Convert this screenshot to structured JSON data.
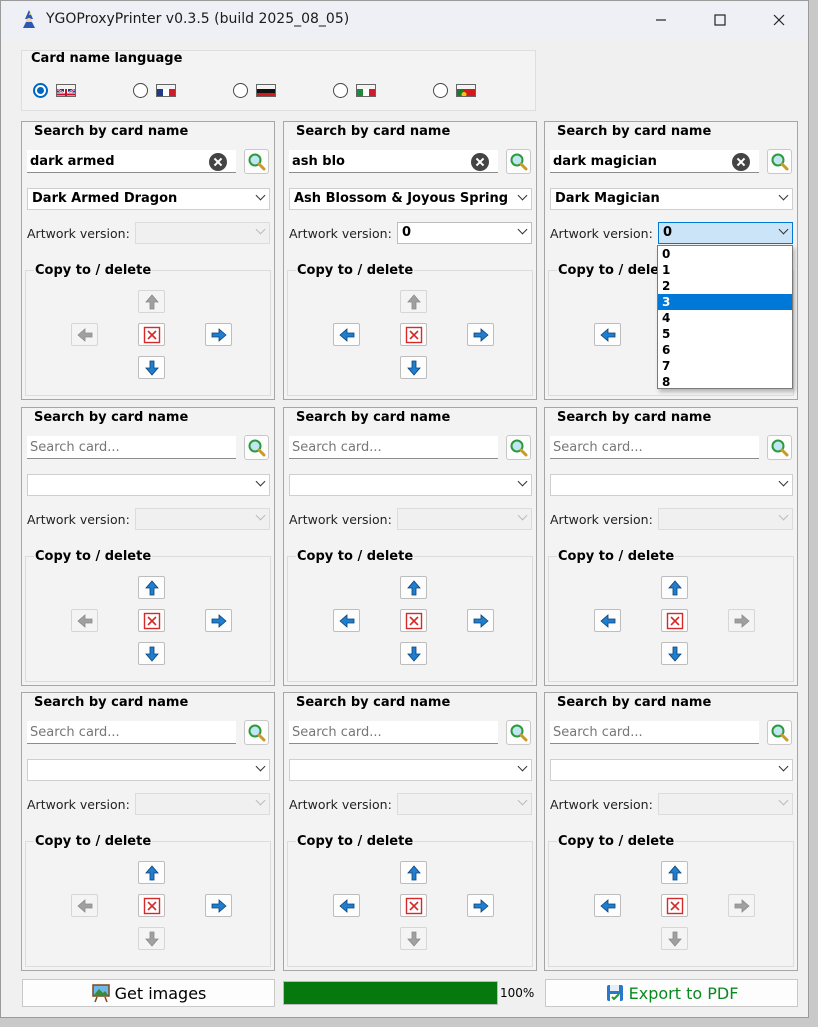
{
  "window": {
    "title": "YGOProxyPrinter v0.3.5 (build 2025_08_05)",
    "controls": [
      "minimize-icon",
      "maximize-icon",
      "close-icon"
    ]
  },
  "language": {
    "label": "Card name language",
    "options": [
      {
        "name": "English",
        "flag": "uk",
        "selected": true
      },
      {
        "name": "French",
        "flag": "france",
        "selected": false
      },
      {
        "name": "German",
        "flag": "germany",
        "selected": false
      },
      {
        "name": "Italian",
        "flag": "italy",
        "selected": false
      },
      {
        "name": "Portuguese",
        "flag": "portugal",
        "selected": false
      }
    ]
  },
  "labels": {
    "search_title": "Search by card name",
    "copy_title": "Copy to / delete",
    "artwork_label": "Artwork version:",
    "search_placeholder": "Search card..."
  },
  "panels": [
    {
      "query": "dark armed",
      "card": "Dark Armed Dragon",
      "artwork": "",
      "art_state": "disabled",
      "arrows": {
        "up": false,
        "left": false,
        "right": true,
        "down": true
      }
    },
    {
      "query": "ash blo",
      "card": "Ash Blossom & Joyous Spring",
      "artwork": "0",
      "art_state": "enabled",
      "arrows": {
        "up": false,
        "left": true,
        "right": true,
        "down": true
      }
    },
    {
      "query": "dark magician",
      "card": "Dark Magician",
      "artwork": "0",
      "art_state": "open",
      "arrows": {
        "up": false,
        "left": true,
        "right": true,
        "down": true
      }
    },
    {
      "query": "",
      "card": "",
      "artwork": "",
      "art_state": "disabled",
      "arrows": {
        "up": true,
        "left": false,
        "right": true,
        "down": true
      }
    },
    {
      "query": "",
      "card": "",
      "artwork": "",
      "art_state": "disabled",
      "arrows": {
        "up": true,
        "left": true,
        "right": true,
        "down": true
      }
    },
    {
      "query": "",
      "card": "",
      "artwork": "",
      "art_state": "disabled",
      "arrows": {
        "up": true,
        "left": true,
        "right": false,
        "down": true
      }
    },
    {
      "query": "",
      "card": "",
      "artwork": "",
      "art_state": "disabled",
      "arrows": {
        "up": true,
        "left": false,
        "right": true,
        "down": false
      }
    },
    {
      "query": "",
      "card": "",
      "artwork": "",
      "art_state": "disabled",
      "arrows": {
        "up": true,
        "left": true,
        "right": true,
        "down": false
      }
    },
    {
      "query": "",
      "card": "",
      "artwork": "",
      "art_state": "disabled",
      "arrows": {
        "up": true,
        "left": true,
        "right": false,
        "down": false
      }
    }
  ],
  "artwork_dropdown": {
    "options": [
      "0",
      "1",
      "2",
      "3",
      "4",
      "5",
      "6",
      "7",
      "8"
    ],
    "highlighted": "3"
  },
  "footer": {
    "get_images_label": "Get images",
    "export_label": "Export to PDF",
    "progress_value": 1.0,
    "progress_text": "100%"
  },
  "colors": {
    "accent": "#0078d7",
    "progress": "#06780d",
    "arrow_blue": "#1e7fd0",
    "export_text": "#0a8a1e",
    "delete_red": "#d42a2a"
  }
}
